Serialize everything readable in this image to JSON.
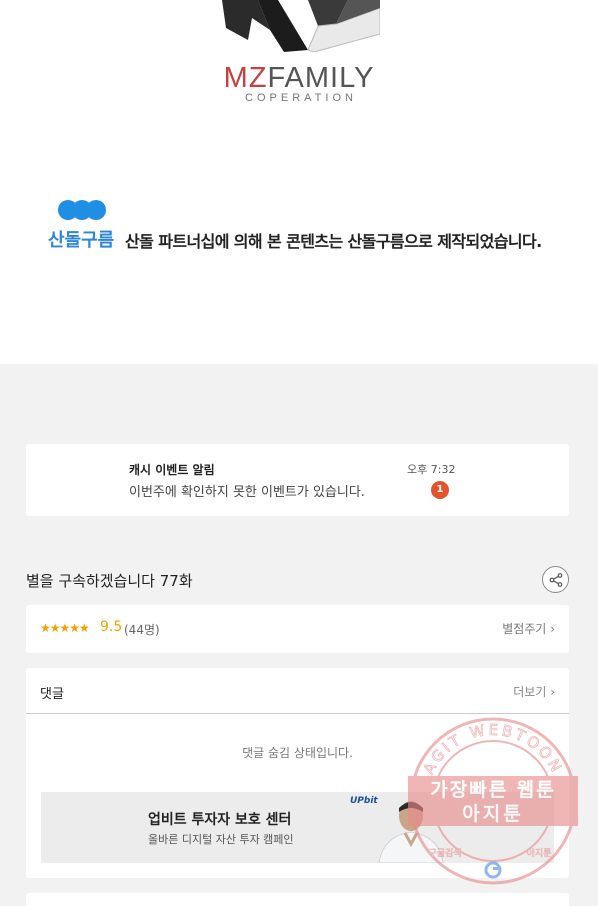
{
  "brand": {
    "name_accent": "MZ",
    "name_rest": "FAMILY",
    "subtitle": "COPERATION"
  },
  "partner": {
    "name": "산돌구름",
    "notice": "산돌 파트너십에 의해 본 콘텐츠는 산돌구름으로 제작되었습니다."
  },
  "notification": {
    "title": "캐시 이벤트 알림",
    "body": "이번주에 확인하지 못한 이벤트가 있습니다.",
    "time": "오후 7:32",
    "badge": "1"
  },
  "episode": {
    "title": "별을 구속하겠습니다 77화"
  },
  "rating": {
    "stars": "★★★★★",
    "score": "9.5",
    "count": "(44명)",
    "action": "별점주기",
    "chevron": "›"
  },
  "comments": {
    "label": "댓글",
    "more": "더보기",
    "chevron": "›",
    "status": "댓글 숨김 상태입니다."
  },
  "ad": {
    "brand": "UPbit",
    "title": "업비트 투자자 보호 센터",
    "subtitle": "올바른 디지털 자산 투자 캠페인"
  },
  "watermark": {
    "arc_text": "AGIT WEBTOON",
    "line1": "가장빠른 웹툰",
    "line2": "아지툰",
    "bottom_left": "구글검색",
    "bottom_right": "아지툰"
  },
  "colors": {
    "accent_red": "#c8403f",
    "partner_blue": "#2c86d8",
    "star": "#f2a100",
    "badge": "#e5532d",
    "watermark": "#e88a8a"
  },
  "icons": {
    "share": "share-icon",
    "rating_stars": "star-icon",
    "google": "google-g-icon"
  }
}
